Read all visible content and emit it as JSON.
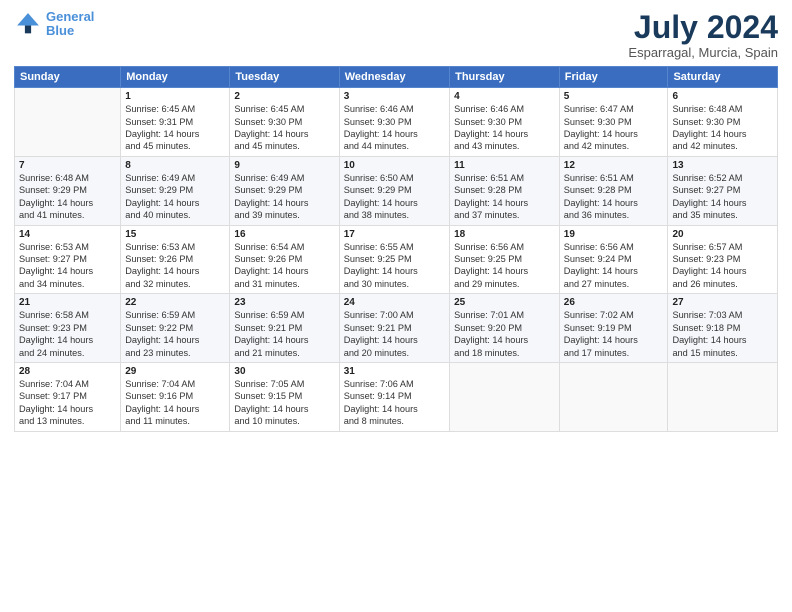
{
  "header": {
    "logo_line1": "General",
    "logo_line2": "Blue",
    "main_title": "July 2024",
    "subtitle": "Esparragal, Murcia, Spain"
  },
  "weekdays": [
    "Sunday",
    "Monday",
    "Tuesday",
    "Wednesday",
    "Thursday",
    "Friday",
    "Saturday"
  ],
  "weeks": [
    [
      {
        "day": "",
        "text": ""
      },
      {
        "day": "1",
        "text": "Sunrise: 6:45 AM\nSunset: 9:31 PM\nDaylight: 14 hours\nand 45 minutes."
      },
      {
        "day": "2",
        "text": "Sunrise: 6:45 AM\nSunset: 9:30 PM\nDaylight: 14 hours\nand 45 minutes."
      },
      {
        "day": "3",
        "text": "Sunrise: 6:46 AM\nSunset: 9:30 PM\nDaylight: 14 hours\nand 44 minutes."
      },
      {
        "day": "4",
        "text": "Sunrise: 6:46 AM\nSunset: 9:30 PM\nDaylight: 14 hours\nand 43 minutes."
      },
      {
        "day": "5",
        "text": "Sunrise: 6:47 AM\nSunset: 9:30 PM\nDaylight: 14 hours\nand 42 minutes."
      },
      {
        "day": "6",
        "text": "Sunrise: 6:48 AM\nSunset: 9:30 PM\nDaylight: 14 hours\nand 42 minutes."
      }
    ],
    [
      {
        "day": "7",
        "text": "Sunrise: 6:48 AM\nSunset: 9:29 PM\nDaylight: 14 hours\nand 41 minutes."
      },
      {
        "day": "8",
        "text": "Sunrise: 6:49 AM\nSunset: 9:29 PM\nDaylight: 14 hours\nand 40 minutes."
      },
      {
        "day": "9",
        "text": "Sunrise: 6:49 AM\nSunset: 9:29 PM\nDaylight: 14 hours\nand 39 minutes."
      },
      {
        "day": "10",
        "text": "Sunrise: 6:50 AM\nSunset: 9:29 PM\nDaylight: 14 hours\nand 38 minutes."
      },
      {
        "day": "11",
        "text": "Sunrise: 6:51 AM\nSunset: 9:28 PM\nDaylight: 14 hours\nand 37 minutes."
      },
      {
        "day": "12",
        "text": "Sunrise: 6:51 AM\nSunset: 9:28 PM\nDaylight: 14 hours\nand 36 minutes."
      },
      {
        "day": "13",
        "text": "Sunrise: 6:52 AM\nSunset: 9:27 PM\nDaylight: 14 hours\nand 35 minutes."
      }
    ],
    [
      {
        "day": "14",
        "text": "Sunrise: 6:53 AM\nSunset: 9:27 PM\nDaylight: 14 hours\nand 34 minutes."
      },
      {
        "day": "15",
        "text": "Sunrise: 6:53 AM\nSunset: 9:26 PM\nDaylight: 14 hours\nand 32 minutes."
      },
      {
        "day": "16",
        "text": "Sunrise: 6:54 AM\nSunset: 9:26 PM\nDaylight: 14 hours\nand 31 minutes."
      },
      {
        "day": "17",
        "text": "Sunrise: 6:55 AM\nSunset: 9:25 PM\nDaylight: 14 hours\nand 30 minutes."
      },
      {
        "day": "18",
        "text": "Sunrise: 6:56 AM\nSunset: 9:25 PM\nDaylight: 14 hours\nand 29 minutes."
      },
      {
        "day": "19",
        "text": "Sunrise: 6:56 AM\nSunset: 9:24 PM\nDaylight: 14 hours\nand 27 minutes."
      },
      {
        "day": "20",
        "text": "Sunrise: 6:57 AM\nSunset: 9:23 PM\nDaylight: 14 hours\nand 26 minutes."
      }
    ],
    [
      {
        "day": "21",
        "text": "Sunrise: 6:58 AM\nSunset: 9:23 PM\nDaylight: 14 hours\nand 24 minutes."
      },
      {
        "day": "22",
        "text": "Sunrise: 6:59 AM\nSunset: 9:22 PM\nDaylight: 14 hours\nand 23 minutes."
      },
      {
        "day": "23",
        "text": "Sunrise: 6:59 AM\nSunset: 9:21 PM\nDaylight: 14 hours\nand 21 minutes."
      },
      {
        "day": "24",
        "text": "Sunrise: 7:00 AM\nSunset: 9:21 PM\nDaylight: 14 hours\nand 20 minutes."
      },
      {
        "day": "25",
        "text": "Sunrise: 7:01 AM\nSunset: 9:20 PM\nDaylight: 14 hours\nand 18 minutes."
      },
      {
        "day": "26",
        "text": "Sunrise: 7:02 AM\nSunset: 9:19 PM\nDaylight: 14 hours\nand 17 minutes."
      },
      {
        "day": "27",
        "text": "Sunrise: 7:03 AM\nSunset: 9:18 PM\nDaylight: 14 hours\nand 15 minutes."
      }
    ],
    [
      {
        "day": "28",
        "text": "Sunrise: 7:04 AM\nSunset: 9:17 PM\nDaylight: 14 hours\nand 13 minutes."
      },
      {
        "day": "29",
        "text": "Sunrise: 7:04 AM\nSunset: 9:16 PM\nDaylight: 14 hours\nand 11 minutes."
      },
      {
        "day": "30",
        "text": "Sunrise: 7:05 AM\nSunset: 9:15 PM\nDaylight: 14 hours\nand 10 minutes."
      },
      {
        "day": "31",
        "text": "Sunrise: 7:06 AM\nSunset: 9:14 PM\nDaylight: 14 hours\nand 8 minutes."
      },
      {
        "day": "",
        "text": ""
      },
      {
        "day": "",
        "text": ""
      },
      {
        "day": "",
        "text": ""
      }
    ]
  ]
}
